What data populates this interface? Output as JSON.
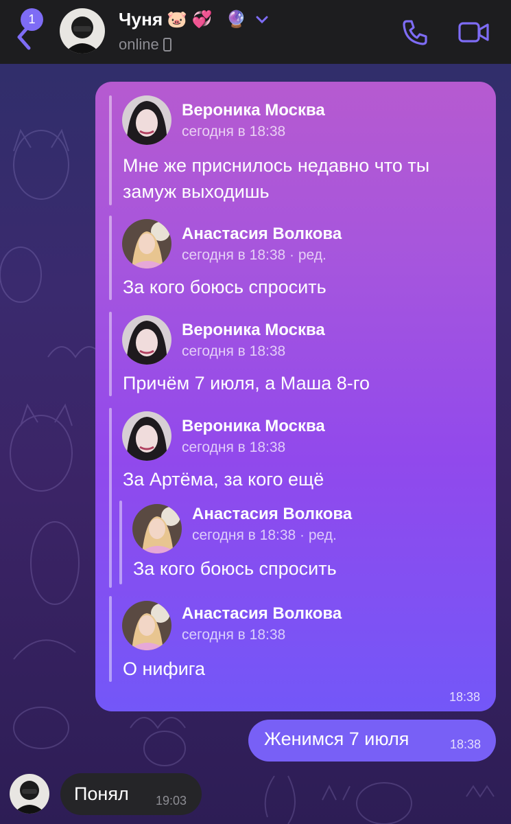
{
  "header": {
    "back_badge": "1",
    "title": "Чуня",
    "title_emojis": [
      "🐷",
      "💞",
      "🔮"
    ],
    "status": "online",
    "icons": [
      "back-icon",
      "chevron-down-icon",
      "mobile-icon",
      "phone-icon",
      "video-icon"
    ]
  },
  "forwarded": {
    "time": "18:38",
    "messages": [
      {
        "author": "Вероника Москва",
        "time": "сегодня в 18:38",
        "text_lines": [
          "Мне же приснилось недавно что ты",
          "замуж выходишь"
        ]
      },
      {
        "author": "Анастасия Волкова",
        "time": "сегодня в 18:38 · ред.",
        "text_lines": [
          "За кого боюсь спросить"
        ]
      },
      {
        "author": "Вероника Москва",
        "time": "сегодня в 18:38",
        "text_lines": [
          "Причём 7 июля, а Маша 8-го"
        ]
      },
      {
        "author": "Вероника Москва",
        "time": "сегодня в 18:38",
        "text_lines": [
          "За Артёма, за кого ещё"
        ],
        "nested": {
          "author": "Анастасия Волкова",
          "time": "сегодня в 18:38 · ред.",
          "text_lines": [
            "За кого боюсь спросить"
          ]
        }
      },
      {
        "author": "Анастасия Волкова",
        "time": "сегодня в 18:38",
        "text_lines": [
          "О нифига"
        ]
      }
    ]
  },
  "outgoing": {
    "text": "Женимся 7 июля",
    "time": "18:38"
  },
  "incoming": {
    "text": "Понял",
    "time": "19:03"
  },
  "colors": {
    "header_bg": "#1d1d1f",
    "accent": "#7e6cf5",
    "bubble_top": "#b65ad0",
    "bubble_bottom": "#7357f8",
    "outgoing": "#7860f6",
    "incoming": "#252528"
  }
}
